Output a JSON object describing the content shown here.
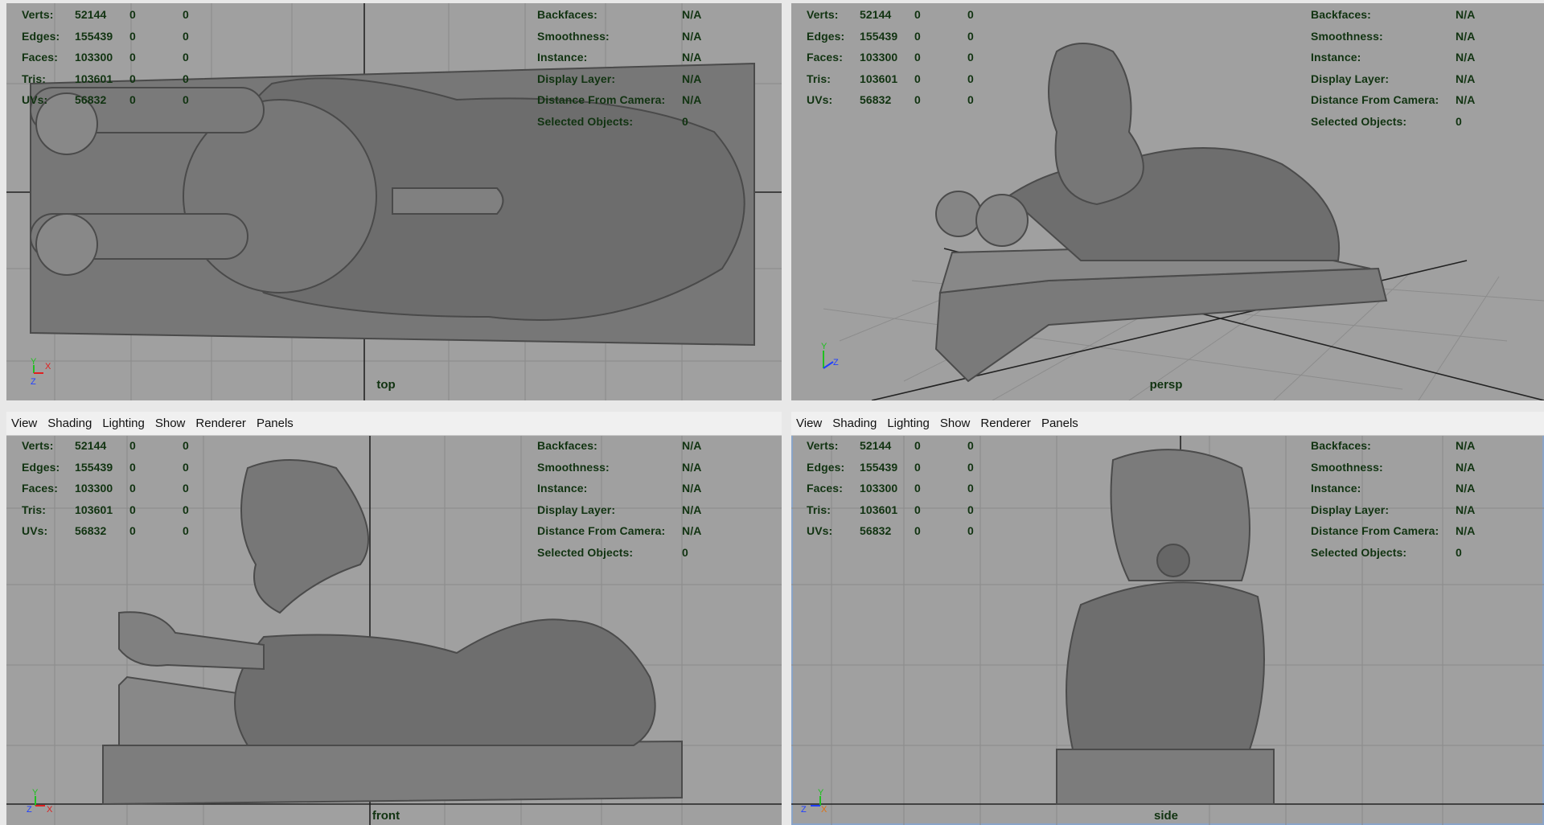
{
  "menu": [
    "View",
    "Shading",
    "Lighting",
    "Show",
    "Renderer",
    "Panels"
  ],
  "hud_left": [
    {
      "label": "Verts:",
      "v1": "52144",
      "v2": "0",
      "v3": "0"
    },
    {
      "label": "Edges:",
      "v1": "155439",
      "v2": "0",
      "v3": "0"
    },
    {
      "label": "Faces:",
      "v1": "103300",
      "v2": "0",
      "v3": "0"
    },
    {
      "label": "Tris:",
      "v1": "103601",
      "v2": "0",
      "v3": "0"
    },
    {
      "label": "UVs:",
      "v1": "56832",
      "v2": "0",
      "v3": "0"
    }
  ],
  "hud_right": [
    {
      "label": "Backfaces:",
      "value": "N/A"
    },
    {
      "label": "Smoothness:",
      "value": "N/A"
    },
    {
      "label": "Instance:",
      "value": "N/A"
    },
    {
      "label": "Display Layer:",
      "value": "N/A"
    },
    {
      "label": "Distance From Camera:",
      "value": "N/A"
    },
    {
      "label": "Selected Objects:",
      "value": "0"
    }
  ],
  "viewports": {
    "top": {
      "camera": "top",
      "axis_a": "Y",
      "axis_b": "X",
      "axis_c": "Z"
    },
    "persp": {
      "camera": "persp",
      "axis_a": "Y",
      "axis_b": "Z"
    },
    "front": {
      "camera": "front",
      "axis_a": "Y",
      "axis_b": "Z",
      "axis_c": "X"
    },
    "side": {
      "camera": "side",
      "axis_a": "Y",
      "axis_b": "Z",
      "axis_c": "X"
    }
  },
  "colors": {
    "viewport_bg": "#a0a0a0",
    "hud_text": "#113311",
    "model": "#6e6e6e",
    "axis_x": "#e02020",
    "axis_y": "#20c020",
    "axis_z": "#2040ff"
  }
}
